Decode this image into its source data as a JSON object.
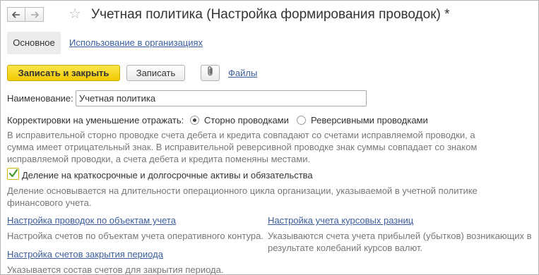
{
  "window": {
    "title": "Учетная политика (Настройка формирования проводок) *",
    "back_icon": "arrow-left-icon",
    "forward_icon": "arrow-right-icon",
    "favorite_icon": "star-icon"
  },
  "tabs": [
    {
      "label": "Основное"
    },
    {
      "label": "Использование в организациях"
    }
  ],
  "toolbar": {
    "save_close_label": "Записать и закрыть",
    "save_label": "Записать",
    "attach_icon": "paperclip-icon",
    "files_label": "Файлы"
  },
  "form": {
    "name_label": "Наименование:",
    "name_value": "Учетная политика",
    "corrections_label": "Корректировки на уменьшение отражать:",
    "corrections_options": [
      {
        "label": "Сторно проводками",
        "selected": true
      },
      {
        "label": "Реверсивными проводками",
        "selected": false
      }
    ],
    "corrections_hint": [
      "В исправительной сторно проводке счета дебета и кредита совпадают со счетами исправляемой проводки, а",
      "сумма имеет отрицательный знак. В исправительной реверсивной проводке знак суммы совпадает со знаком",
      "исправляемой проводки, а счета дебета и кредита поменяны местами."
    ],
    "division_checkbox_label": "Деление на краткосрочные и долгосрочные активы и обязательства",
    "division_checked": true,
    "division_hint": [
      "Деление основывается на длительности операционного цикла организации, указываемой в учетной политике",
      "финансового учета."
    ]
  },
  "links": {
    "accounts_objects": {
      "label": "Настройка проводок по объектам учета",
      "hint": "Настройка счетов по объектам учета оперативного контура."
    },
    "exchange_diffs": {
      "label": "Настройка учета курсовых разниц",
      "hint": [
        "Указываются счета учета прибылей (убытков) возникающих в",
        "результате колебаний курсов валют."
      ]
    },
    "period_close": {
      "label": "Настройка счетов закрытия периода",
      "hint": "Указывается состав счетов для закрытия периода."
    }
  },
  "colors": {
    "accent_yellow": "#f2c900",
    "link_blue": "#3b5e9e",
    "hint_gray": "#777777",
    "check_green": "#3f9a2e"
  }
}
